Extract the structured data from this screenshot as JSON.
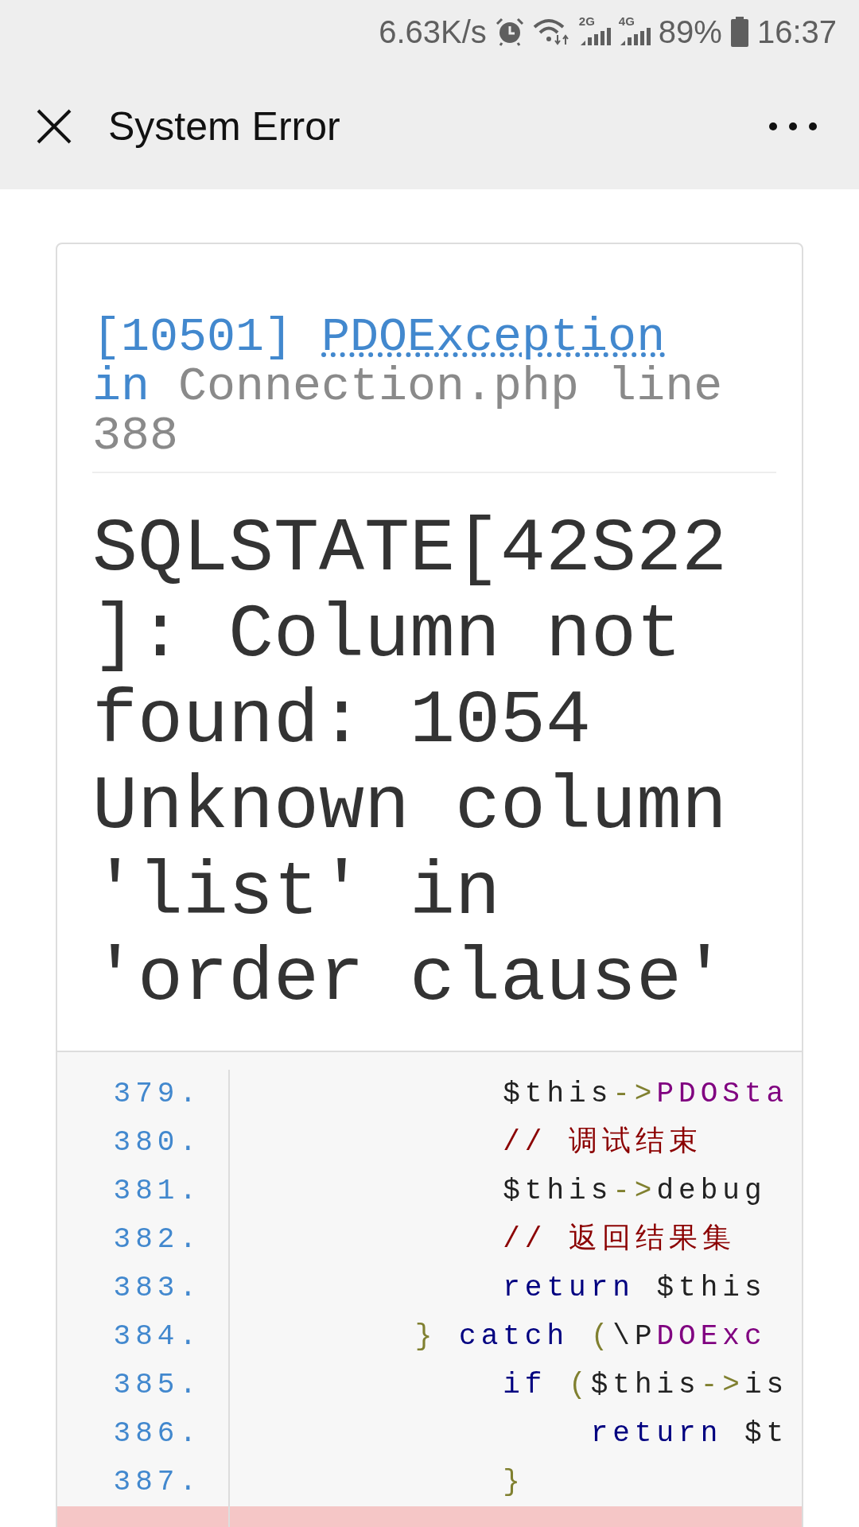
{
  "status_bar": {
    "speed": "6.63K/s",
    "networks": [
      "2G",
      "4G"
    ],
    "battery": "89%",
    "time": "16:37"
  },
  "header": {
    "title": "System Error"
  },
  "error": {
    "code": "[10501]",
    "exception": "PDOException",
    "location_prefix": "in",
    "location": "Connection.php line 388",
    "message": "SQLSTATE[42S22]: Column not found: 1054 Unknown column 'list' in 'order clause'"
  },
  "code_lines": [
    {
      "number": "379.",
      "highlighted": false,
      "tokens": [
        {
          "kind": "plain",
          "text": "            $this"
        },
        {
          "kind": "op",
          "text": "->"
        },
        {
          "kind": "cls",
          "text": "PDOSta"
        }
      ]
    },
    {
      "number": "380.",
      "highlighted": false,
      "tokens": [
        {
          "kind": "comment",
          "text": "            // 调试结束"
        }
      ]
    },
    {
      "number": "381.",
      "highlighted": false,
      "tokens": [
        {
          "kind": "plain",
          "text": "            $this"
        },
        {
          "kind": "op",
          "text": "->"
        },
        {
          "kind": "plain",
          "text": "debug"
        }
      ]
    },
    {
      "number": "382.",
      "highlighted": false,
      "tokens": [
        {
          "kind": "comment",
          "text": "            // 返回结果集"
        }
      ]
    },
    {
      "number": "383.",
      "highlighted": false,
      "tokens": [
        {
          "kind": "kw",
          "text": "            return"
        },
        {
          "kind": "plain",
          "text": " $this"
        }
      ]
    },
    {
      "number": "384.",
      "highlighted": false,
      "tokens": [
        {
          "kind": "op",
          "text": "        }"
        },
        {
          "kind": "kw",
          "text": " catch"
        },
        {
          "kind": "op",
          "text": " ("
        },
        {
          "kind": "plain",
          "text": "\\P"
        },
        {
          "kind": "cls",
          "text": "DOExc"
        }
      ]
    },
    {
      "number": "385.",
      "highlighted": false,
      "tokens": [
        {
          "kind": "kw",
          "text": "            if"
        },
        {
          "kind": "op",
          "text": " ("
        },
        {
          "kind": "plain",
          "text": "$this"
        },
        {
          "kind": "op",
          "text": "->"
        },
        {
          "kind": "plain",
          "text": "is"
        }
      ]
    },
    {
      "number": "386.",
      "highlighted": false,
      "tokens": [
        {
          "kind": "kw",
          "text": "                return"
        },
        {
          "kind": "plain",
          "text": " $t"
        }
      ]
    },
    {
      "number": "387.",
      "highlighted": false,
      "tokens": [
        {
          "kind": "op",
          "text": "            }"
        }
      ]
    },
    {
      "highlighted": true
    }
  ]
}
